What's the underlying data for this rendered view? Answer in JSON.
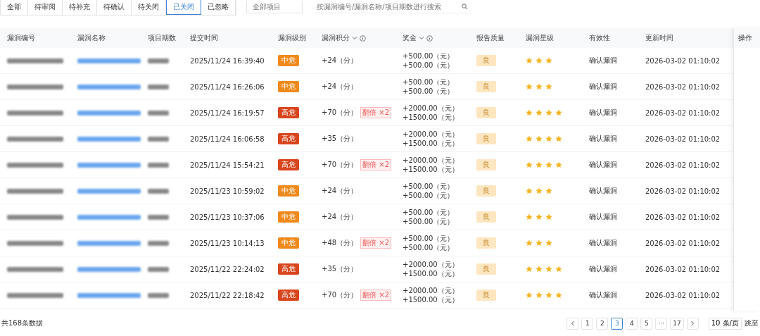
{
  "tabs": [
    {
      "label": "全部",
      "selected": false
    },
    {
      "label": "待审阅",
      "selected": false
    },
    {
      "label": "待补充",
      "selected": false
    },
    {
      "label": "待确认",
      "selected": false
    },
    {
      "label": "待关闭",
      "selected": false
    },
    {
      "label": "已关闭",
      "selected": true
    },
    {
      "label": "已忽略",
      "selected": false
    }
  ],
  "project_select": {
    "placeholder": "全部项目"
  },
  "search": {
    "placeholder": "按漏洞编号/漏洞名称/项目期数进行搜索"
  },
  "table": {
    "columns": [
      {
        "label": "漏洞编号",
        "kind": "plain"
      },
      {
        "label": "漏洞名称",
        "kind": "plain"
      },
      {
        "label": "项目期数",
        "kind": "plain"
      },
      {
        "label": "提交时间",
        "kind": "plain"
      },
      {
        "label": "漏洞级别",
        "kind": "plain"
      },
      {
        "label": "漏洞积分",
        "kind": "sort_info"
      },
      {
        "label": "奖金",
        "kind": "sort_info"
      },
      {
        "label": "报告质量",
        "kind": "plain"
      },
      {
        "label": "漏洞星级",
        "kind": "plain"
      },
      {
        "label": "有效性",
        "kind": "plain"
      },
      {
        "label": "更新时间",
        "kind": "plain"
      }
    ],
    "action_column": "操作",
    "rows": [
      {
        "submitted": "2025/11/24 16:39:40",
        "level": "中危",
        "color": "#f08a1c",
        "points": "+24（分）",
        "bonus": "+500.00（元）+500.00（元）",
        "quality": "良",
        "stars": 3,
        "validity": "确认漏洞",
        "updated": "2026-03-02 01:10:02"
      },
      {
        "submitted": "2025/11/24 16:26:06",
        "level": "中危",
        "color": "#f08a1c",
        "points": "+24（分）",
        "bonus": "+500.00（元）+500.00（元）",
        "quality": "良",
        "stars": 3,
        "validity": "确认漏洞",
        "updated": "2026-03-02 01:10:02"
      },
      {
        "submitted": "2025/11/24 16:19:57",
        "level": "高危",
        "color": "#d8441c",
        "points": "+70（分）",
        "tag": "翻倍 ×2",
        "bonus": "+2000.00（元）+1500.00（元）",
        "quality": "良",
        "stars": 4,
        "validity": "确认漏洞",
        "updated": "2026-03-02 01:10:02"
      },
      {
        "submitted": "2025/11/24 16:06:58",
        "level": "高危",
        "color": "#d8441c",
        "points": "+35（分）",
        "bonus": "+2000.00（元）+1500.00（元）",
        "quality": "良",
        "stars": 4,
        "validity": "确认漏洞",
        "updated": "2026-03-02 01:10:02"
      },
      {
        "submitted": "2025/11/24 15:54:21",
        "level": "高危",
        "color": "#d8441c",
        "points": "+70（分）",
        "tag": "翻倍 ×2",
        "bonus": "+2000.00（元）+1500.00（元）",
        "quality": "良",
        "stars": 4,
        "validity": "确认漏洞",
        "updated": "2026-03-02 01:10:02"
      },
      {
        "submitted": "2025/11/23 10:59:02",
        "level": "中危",
        "color": "#f08a1c",
        "points": "+24（分）",
        "bonus": "+500.00（元）+500.00（元）",
        "quality": "良",
        "stars": 3,
        "validity": "确认漏洞",
        "updated": "2026-03-02 01:10:02"
      },
      {
        "submitted": "2025/11/23 10:37:06",
        "level": "中危",
        "color": "#f08a1c",
        "points": "+24（分）",
        "bonus": "+500.00（元）+500.00（元）",
        "quality": "良",
        "stars": 3,
        "validity": "确认漏洞",
        "updated": "2026-03-02 01:10:02"
      },
      {
        "submitted": "2025/11/23 10:14:13",
        "level": "中危",
        "color": "#f08a1c",
        "points": "+48（分）",
        "tag": "翻倍 ×2",
        "bonus": "+500.00（元）+500.00（元）",
        "quality": "良",
        "stars": 3,
        "validity": "确认漏洞",
        "updated": "2026-03-02 01:10:02"
      },
      {
        "submitted": "2025/11/22 22:24:02",
        "level": "高危",
        "color": "#d8441c",
        "points": "+35（分）",
        "bonus": "+2000.00（元）+1500.00（元）",
        "quality": "良",
        "stars": 4,
        "validity": "确认漏洞",
        "updated": "2026-03-02 01:10:02"
      },
      {
        "submitted": "2025/11/22 22:18:42",
        "level": "高危",
        "color": "#d8441c",
        "points": "+70（分）",
        "tag": "翻倍 ×2",
        "bonus": "+2000.00（元）+1500.00（元）",
        "quality": "良",
        "stars": 4,
        "validity": "确认漏洞",
        "updated": "2026-03-02 01:10:02"
      }
    ]
  },
  "pagination": {
    "total": "共168条数据",
    "pages": [
      {
        "label": "1",
        "selected": false
      },
      {
        "label": "2",
        "selected": false
      },
      {
        "label": "3",
        "selected": true
      },
      {
        "label": "4",
        "selected": false
      },
      {
        "label": "5",
        "selected": false
      },
      {
        "label": "···",
        "selected": false
      },
      {
        "label": "17",
        "selected": false
      }
    ],
    "page_size": "10 条/页",
    "jump": "跳至"
  }
}
